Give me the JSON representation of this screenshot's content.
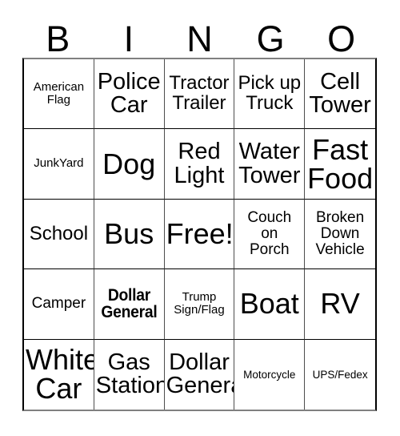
{
  "card": {
    "title": "BINGO",
    "header_letters": [
      "B",
      "I",
      "N",
      "G",
      "O"
    ],
    "colors": {
      "background": "#ffffff",
      "text": "#000000",
      "grid_line": "#000000",
      "grid_line_light": "#808080"
    },
    "rows": 5,
    "columns": 5,
    "free_space": "Free!",
    "cells": [
      {
        "text": "American\nFlag",
        "size": "fs-sm",
        "bold": false
      },
      {
        "text": "Police\nCar",
        "size": "fs-xl",
        "bold": false
      },
      {
        "text": "Tractor\nTrailer",
        "size": "fs-lg",
        "bold": false
      },
      {
        "text": "Pick up\nTruck",
        "size": "fs-lg",
        "bold": false
      },
      {
        "text": "Cell\nTower",
        "size": "fs-xl",
        "bold": false
      },
      {
        "text": "JunkYard",
        "size": "fs-sm",
        "bold": false
      },
      {
        "text": "Dog",
        "size": "fs-xxl",
        "bold": false
      },
      {
        "text": "Red\nLight",
        "size": "fs-xl",
        "bold": false
      },
      {
        "text": "Water\nTower",
        "size": "fs-xl",
        "bold": false
      },
      {
        "text": "Fast\nFood",
        "size": "fs-xxl",
        "bold": false
      },
      {
        "text": "School",
        "size": "fs-lg",
        "bold": false
      },
      {
        "text": "Bus",
        "size": "fs-xxl",
        "bold": false
      },
      {
        "text": "Free!",
        "size": "fs-xxl",
        "bold": false
      },
      {
        "text": "Couch\non\nPorch",
        "size": "fs-md",
        "bold": false
      },
      {
        "text": "Broken\nDown\nVehicle",
        "size": "fs-md",
        "bold": false
      },
      {
        "text": "Camper",
        "size": "fs-md",
        "bold": false
      },
      {
        "text": "Dollar\nGeneral",
        "size": "squeezed-bold",
        "bold": true
      },
      {
        "text": "Trump\nSign/Flag",
        "size": "fs-sm",
        "bold": false
      },
      {
        "text": "Boat",
        "size": "fs-xxl",
        "bold": false
      },
      {
        "text": "RV",
        "size": "fs-xxl",
        "bold": false
      },
      {
        "text": "White\nCar",
        "size": "fs-xxl",
        "bold": false
      },
      {
        "text": "Gas\nStation",
        "size": "fs-xl",
        "bold": false
      },
      {
        "text": "Dollar\nGeneral",
        "size": "fs-xl",
        "bold": false
      },
      {
        "text": "Motorcycle",
        "size": "fs-xs",
        "bold": false
      },
      {
        "text": "UPS/Fedex",
        "size": "fs-xs",
        "bold": false
      }
    ]
  }
}
